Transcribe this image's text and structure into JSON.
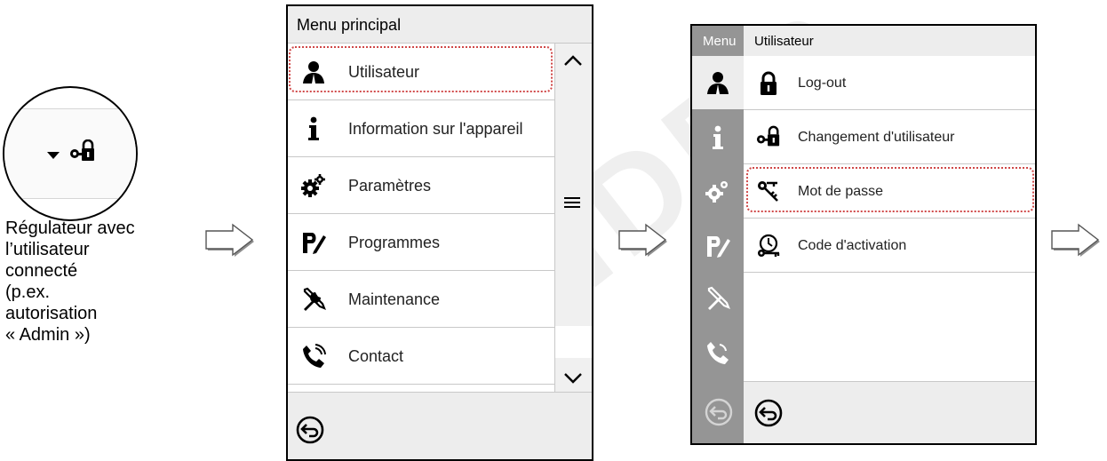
{
  "watermark": "BINDER",
  "magnifier": {
    "caption": [
      "Régulateur avec",
      "l’utilisateur",
      "connecté",
      "(p.ex.",
      "autorisation",
      "« Admin »)"
    ]
  },
  "screen1": {
    "title": "Menu principal",
    "items": [
      {
        "label": "Utilisateur",
        "icon": "user-icon"
      },
      {
        "label": "Information sur l'appareil",
        "icon": "info-icon"
      },
      {
        "label": "Paramètres",
        "icon": "gears-icon"
      },
      {
        "label": "Programmes",
        "icon": "program-icon"
      },
      {
        "label": "Maintenance",
        "icon": "tools-icon"
      },
      {
        "label": "Contact",
        "icon": "phone-icon"
      }
    ],
    "selected": "Utilisateur"
  },
  "screen2": {
    "sidebar_title": "Menu",
    "title": "Utilisateur",
    "items": [
      {
        "label": "Log-out",
        "icon": "lock-icon"
      },
      {
        "label": "Changement d'utilisateur",
        "icon": "key-lock-icon"
      },
      {
        "label": "Mot de passe",
        "icon": "keys-icon"
      },
      {
        "label": "Code d'activation",
        "icon": "activation-code-icon"
      }
    ],
    "selected": "Mot de passe"
  },
  "colors": {
    "highlight": "#d04848",
    "sidebar": "#959595",
    "header": "#ededed"
  }
}
